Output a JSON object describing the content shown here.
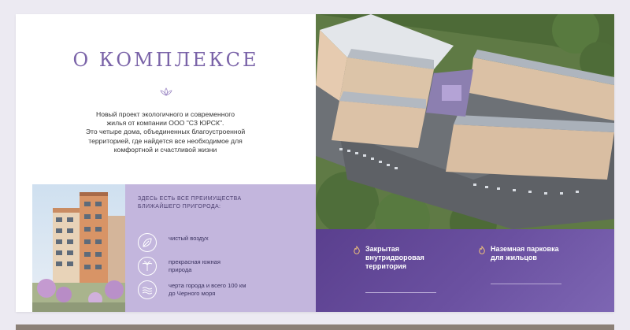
{
  "section": {
    "title": "О КОМПЛЕКСЕ",
    "description_lines": [
      "Новый проект экологичного и современного",
      "жилья от компании ООО \"СЗ ЮРСК\".",
      "Это четыре дома, объединенных благоустроенной",
      "территорией, где найдется все необходимое для",
      "комфортной и счастливой жизни"
    ]
  },
  "advantages": {
    "heading_line1": "ЗДЕСЬ ЕСТЬ ВСЕ ПРЕИМУЩЕСТВА",
    "heading_line2": "БЛИЖАЙШЕГО ПРИГОРОДА:",
    "items": [
      {
        "icon": "leaf-icon",
        "line1": "чистый воздух",
        "line2": ""
      },
      {
        "icon": "palm-icon",
        "line1": "прекрасная южная",
        "line2": "природа"
      },
      {
        "icon": "waves-icon",
        "line1": "черта города и всего 100 км",
        "line2": "до Черного моря"
      }
    ]
  },
  "features": [
    {
      "icon": "flame-icon",
      "line1": "Закрытая",
      "line2": "внутридворовая",
      "line3": "территория"
    },
    {
      "icon": "flame-icon",
      "line1": "Наземная парковка",
      "line2": "для жильцов",
      "line3": ""
    }
  ],
  "colors": {
    "accent": "#7a63a8",
    "panel": "#c3b6dd",
    "purple": "#5a3f8e"
  }
}
